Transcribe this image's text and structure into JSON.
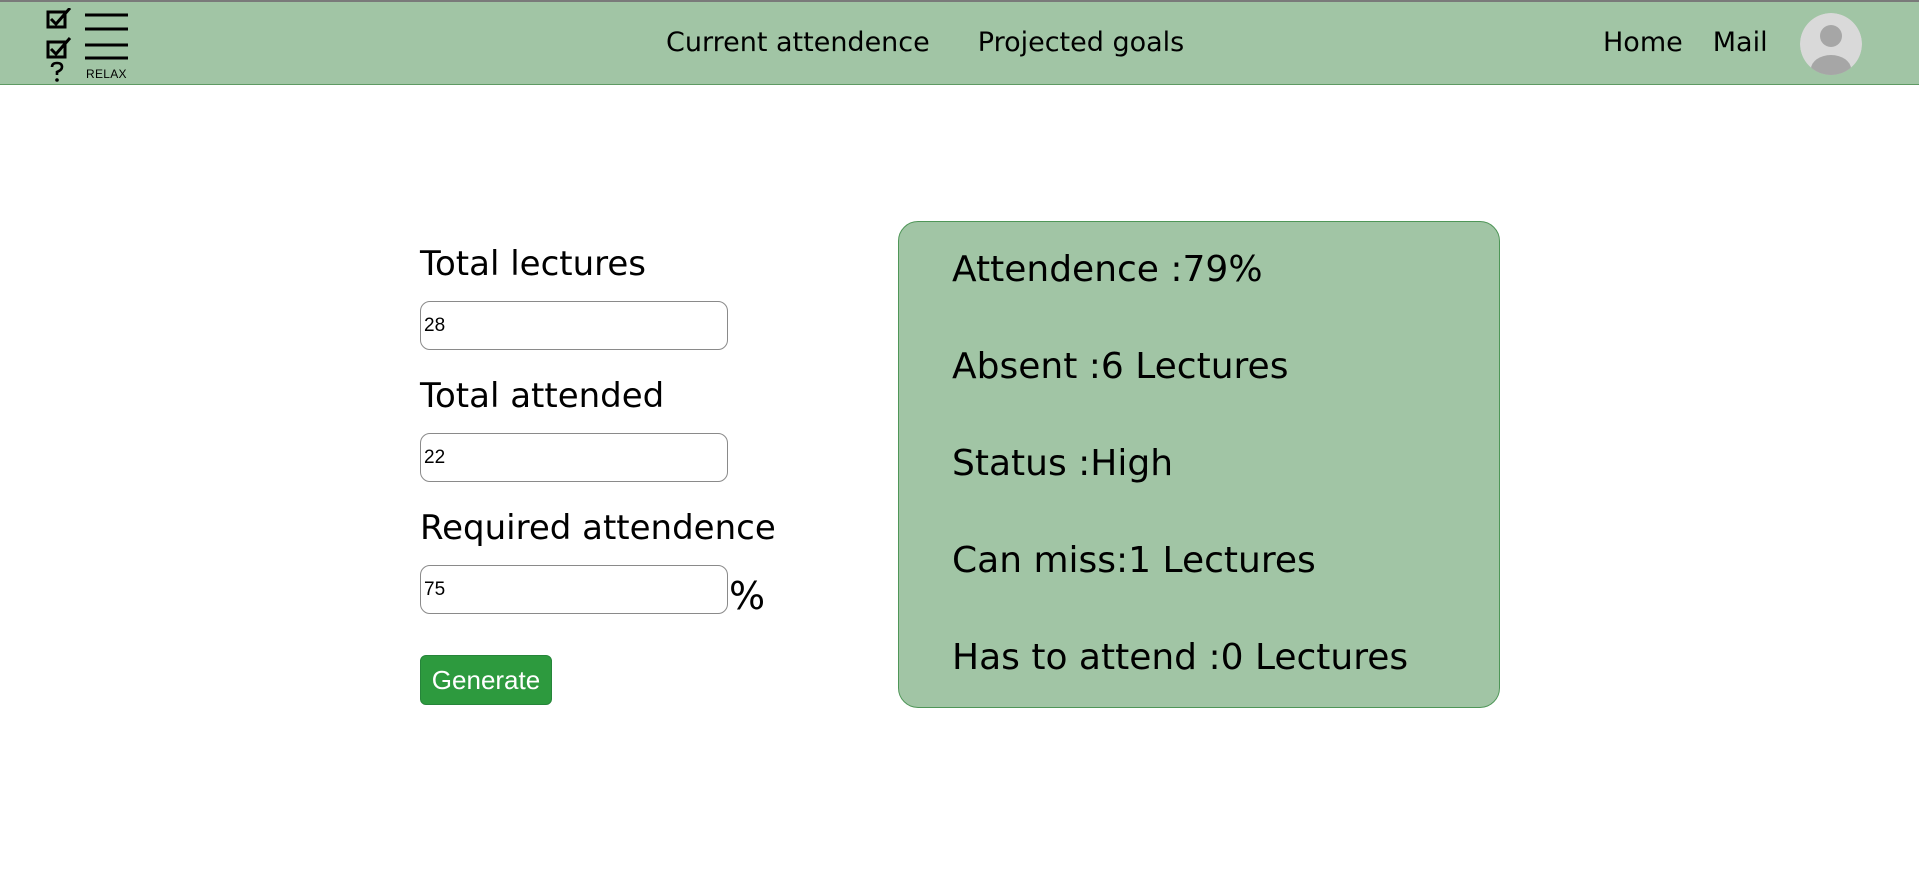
{
  "brand": {
    "logo_text": "RELAX"
  },
  "nav": {
    "center_links": [
      "Current attendence",
      "Projected goals"
    ],
    "right_links": [
      "Home",
      "Mail"
    ]
  },
  "form": {
    "total_lectures_label": "Total lectures",
    "total_lectures_value": "28",
    "total_attended_label": "Total attended",
    "total_attended_value": "22",
    "required_label": "Required attendence",
    "required_value": "75",
    "percent_sign": "%",
    "generate_label": "Generate"
  },
  "results": {
    "attendance": "Attendence :79%",
    "absent": "Absent :6 Lectures",
    "status": "Status :High",
    "can_miss": "Can miss:1 Lectures",
    "has_to_attend": "Has to attend :0 Lectures"
  },
  "colors": {
    "nav_background": "#a1c5a5",
    "card_background": "#a1c5a5",
    "button_background": "#2d9a3e"
  }
}
